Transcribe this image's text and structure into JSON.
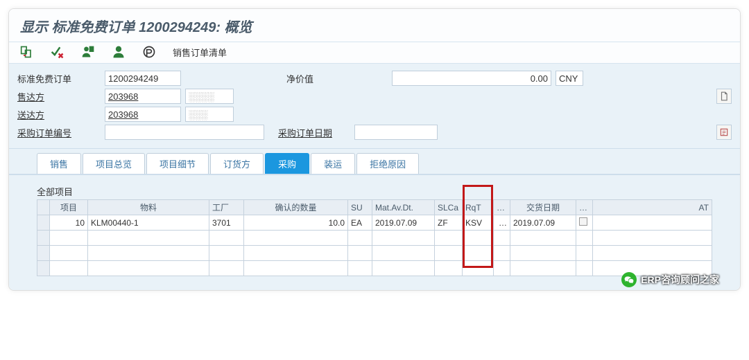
{
  "title": "显示 标准免费订单 1200294249: 概览",
  "toolbar": {
    "sales_order_list": "销售订单清单"
  },
  "form": {
    "order_type_label": "标准免费订单",
    "order_no": "1200294249",
    "net_value_label": "净价值",
    "net_value": "0.00",
    "currency": "CNY",
    "sold_to_label": "售达方",
    "sold_to_code": "203968",
    "sold_to_name": "░░░░",
    "ship_to_label": "送达方",
    "ship_to_code": "203968",
    "ship_to_name": "░░░",
    "po_no_label": "采购订单编号",
    "po_no": "",
    "po_date_label": "采购订单日期",
    "po_date": ""
  },
  "tabs": {
    "sales": "销售",
    "item_overview": "项目总览",
    "item_detail": "项目细节",
    "ordering": "订货方",
    "procurement": "采购",
    "shipping": "装运",
    "rejection": "拒绝原因"
  },
  "grid": {
    "title": "全部项目",
    "cols": {
      "item": "项目",
      "material": "物料",
      "plant": "工厂",
      "confirmed_qty": "确认的数量",
      "su": "SU",
      "mat_av_dt": "Mat.Av.Dt.",
      "slca": "SLCa",
      "rqt": "RqT",
      "dots": "…",
      "deliv_date": "交货日期",
      "dots2": "…",
      "at": "AT"
    },
    "row1": {
      "item": "10",
      "material": "KLM00440-1",
      "plant": "3701",
      "confirmed_qty": "10.0",
      "su": "EA",
      "mat_av_dt": "2019.07.09",
      "slca": "ZF",
      "rqt": "KSV",
      "dots": "…",
      "deliv_date": "2019.07.09"
    }
  },
  "watermark": "ERP咨询顾问之家"
}
